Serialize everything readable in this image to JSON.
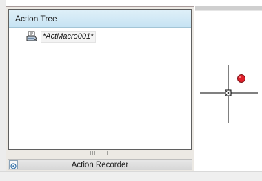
{
  "palette": {
    "panel_title": "Action Tree",
    "tree_items": [
      {
        "label": "*ActMacro001*",
        "icon": "macro-icon"
      }
    ],
    "footer_label": "Action Recorder",
    "footer_icon": "recorder-toggle-icon"
  },
  "canvas": {
    "cursor_icon": "crosshair-cursor-icon",
    "marker_icon": "record-indicator-icon"
  },
  "colors": {
    "header_bg": "#c7e3f3",
    "record_red": "#e0202a"
  }
}
